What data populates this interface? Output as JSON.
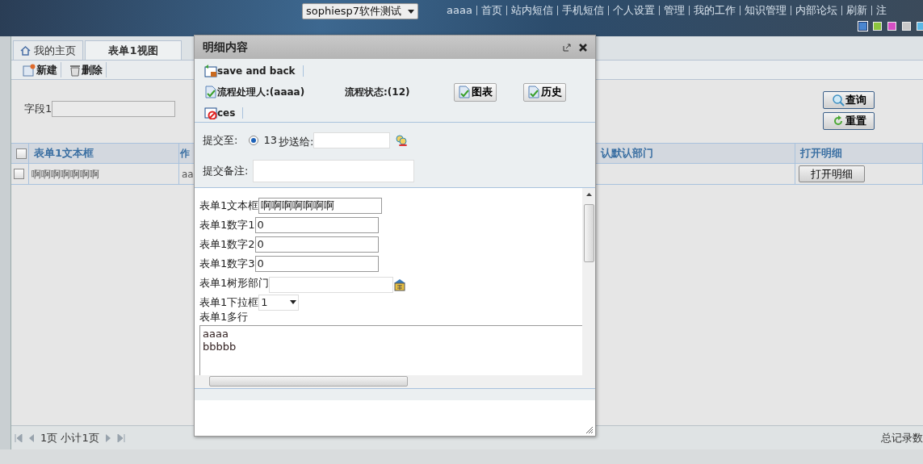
{
  "header": {
    "site_select": "sophiesp7软件测试",
    "nav_links": [
      "aaaa",
      "首页",
      "站内短信",
      "手机短信",
      "个人设置",
      "管理",
      "我的工作",
      "知识管理",
      "内部论坛",
      "刷新",
      "注"
    ],
    "theme_swatches": [
      {
        "color": "#4a86d0",
        "selected": true
      },
      {
        "color": "#8cc63f",
        "selected": false
      },
      {
        "color": "#d54fc4",
        "selected": false
      },
      {
        "color": "#c8c8c8",
        "selected": false
      },
      {
        "color": "#5cb8e6",
        "selected": false
      }
    ]
  },
  "tabs": [
    {
      "label": "我的主页",
      "selected": false
    },
    {
      "label": "表单1视图",
      "selected": true
    }
  ],
  "toolbar": [
    "新建",
    "删除"
  ],
  "search": {
    "field_label": "字段1",
    "buttons": [
      "查询",
      "重置"
    ]
  },
  "table": {
    "select_all_checked": false,
    "columns": [
      "表单1文本框",
      "作",
      "认默认部门",
      "打开明细"
    ],
    "rows": [
      {
        "checked": false,
        "cells": [
          "啊啊啊啊啊啊啊",
          "aa",
          ""
        ],
        "action": "打开明细"
      }
    ]
  },
  "pager": {
    "info": "1页 小计1页",
    "total": "总记录数"
  },
  "dialog": {
    "title": "明细内容",
    "actions": [
      "save and back",
      "ces"
    ],
    "handler": "流程处理人:(aaaa)",
    "status": "流程状态:(12)",
    "buttons": [
      "图表",
      "历史"
    ],
    "submit_to_label": "提交至:",
    "submit_option": {
      "label": "13",
      "selected": true
    },
    "cc_label": "抄送给:",
    "remark_label": "提交备注:",
    "fields": [
      {
        "kind": "text",
        "label": "表单1文本框",
        "value": "啊啊啊啊啊啊啊"
      },
      {
        "kind": "text",
        "label": "表单1数字1",
        "value": "0"
      },
      {
        "kind": "text",
        "label": "表单1数字2",
        "value": "0"
      },
      {
        "kind": "text",
        "label": "表单1数字3",
        "value": "0"
      },
      {
        "kind": "tree",
        "label": "表单1树形部门"
      },
      {
        "kind": "select",
        "label": "表单1下拉框",
        "value": "1"
      },
      {
        "kind": "textarea",
        "label": "表单1多行",
        "value": "aaaa\nbbbbb"
      }
    ]
  }
}
